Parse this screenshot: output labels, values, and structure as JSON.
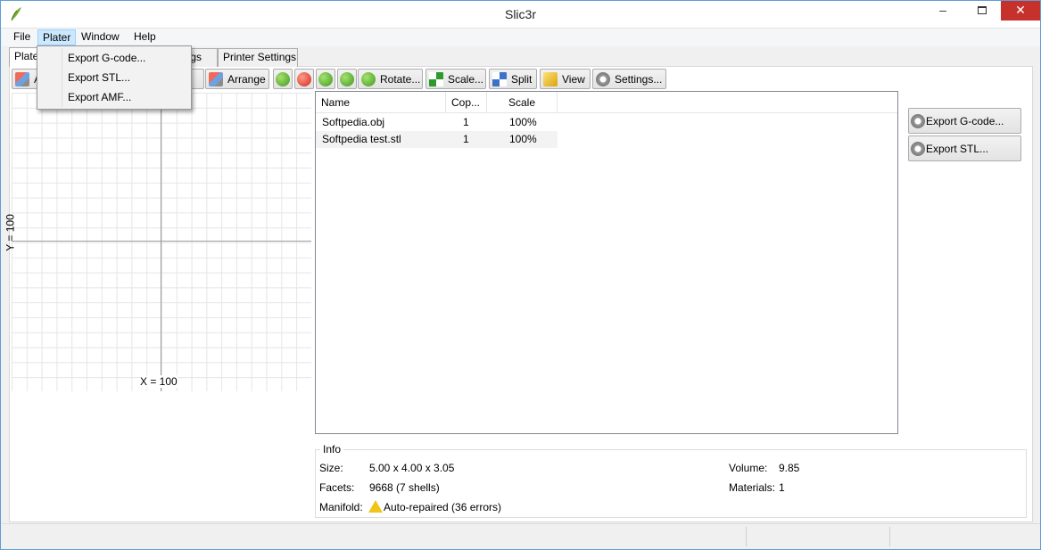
{
  "window": {
    "title": "Slic3r"
  },
  "menu": {
    "items": [
      "File",
      "Plater",
      "Window",
      "Help"
    ]
  },
  "plater_menu": {
    "items": [
      "Export G-code...",
      "Export STL...",
      "Export AMF..."
    ]
  },
  "tabs": [
    {
      "label": "Plate"
    },
    {
      "label": "ings"
    },
    {
      "label": "Printer Settings"
    }
  ],
  "toolbar": {
    "items": {
      "arrange": "Arrange",
      "rotate": "Rotate...",
      "scale": "Scale...",
      "split": "Split",
      "view": "View",
      "settings": "Settings..."
    },
    "partial_hidden": {
      "a": "A",
      "ll": "ll"
    }
  },
  "plate": {
    "x_label": "X = 100",
    "y_label": "Y = 100"
  },
  "object_list": {
    "columns": [
      "Name",
      "Cop...",
      "Scale"
    ],
    "rows": [
      {
        "name": "Softpedia.obj",
        "copies": "1",
        "scale": "100%"
      },
      {
        "name": "Softpedia test.stl",
        "copies": "1",
        "scale": "100%"
      }
    ]
  },
  "right_buttons": {
    "export_gcode": "Export G-code...",
    "export_stl": "Export STL..."
  },
  "info": {
    "legend": "Info",
    "size_label": "Size:",
    "size_value": "5.00 x 4.00 x 3.05",
    "facets_label": "Facets:",
    "facets_value": "9668 (7 shells)",
    "manifold_label": "Manifold:",
    "manifold_value": "Auto-repaired (36 errors)",
    "volume_label": "Volume:",
    "volume_value": "9.85",
    "materials_label": "Materials:",
    "materials_value": "1"
  },
  "colors": {
    "accent": "#cce8ff",
    "close": "#c7312b",
    "border": "#5f9ed6"
  }
}
